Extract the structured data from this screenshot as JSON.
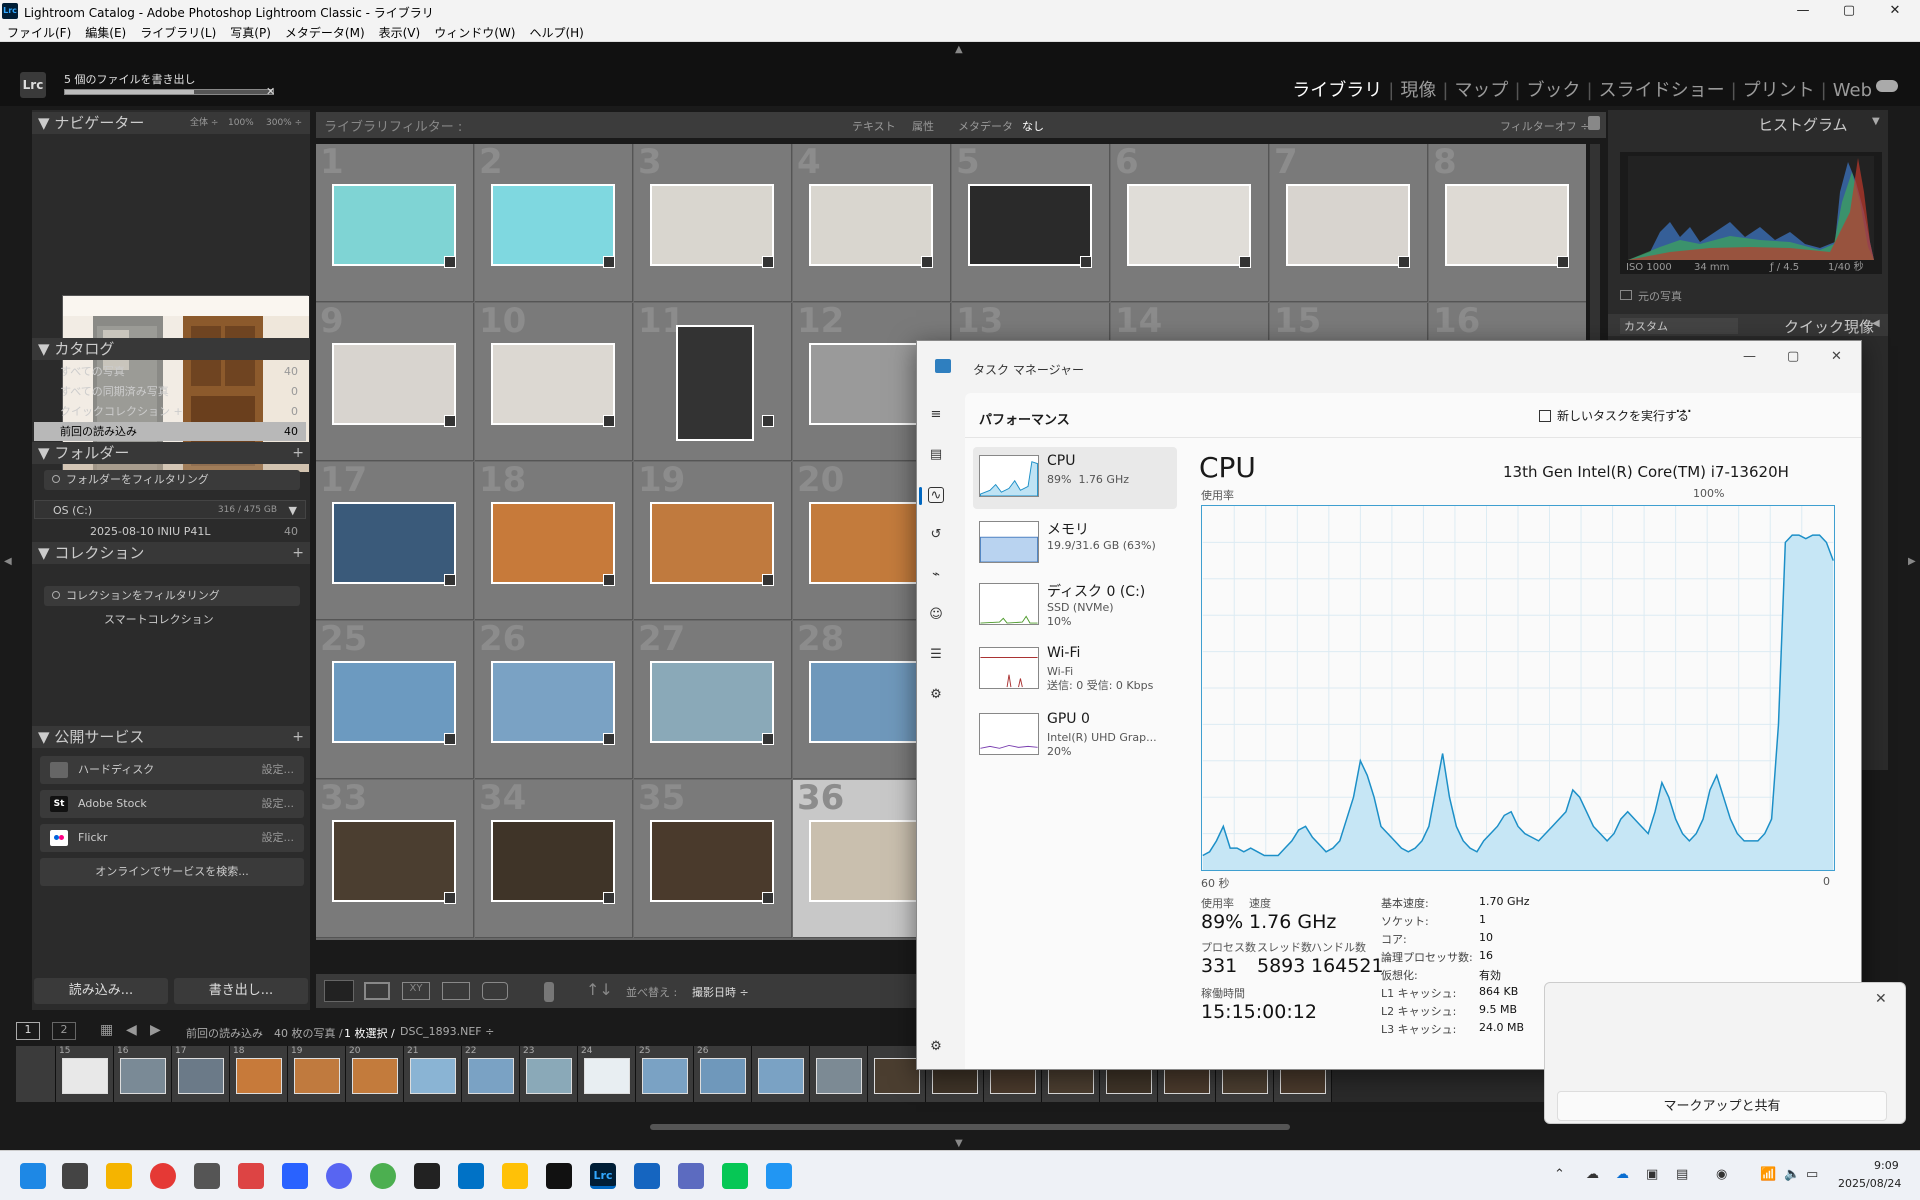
{
  "window": {
    "title": "Lightroom Catalog - Adobe Photoshop Lightroom Classic - ライブラリ",
    "lrc_badge": "Lrc",
    "minimize": "—",
    "maximize": "▢",
    "close": "✕"
  },
  "menu": [
    "ファイル(F)",
    "編集(E)",
    "ライブラリ(L)",
    "写真(P)",
    "メタデータ(M)",
    "表示(V)",
    "ウィンドウ(W)",
    "ヘルプ(H)"
  ],
  "lr": {
    "logo": "Lrc",
    "progress": {
      "label": "5 個のファイルを書き出し",
      "fraction": 0.62,
      "close": "✕"
    },
    "modules": [
      "ライブラリ",
      "現像",
      "マップ",
      "ブック",
      "スライドショー",
      "プリント",
      "Web"
    ],
    "active_module": "ライブラリ",
    "navigator": {
      "title": "ナビゲーター",
      "options": [
        "全体 ÷",
        "100%",
        "300% ÷"
      ]
    },
    "catalog": {
      "title": "カタログ",
      "items": [
        {
          "label": "すべての写真",
          "count": "40"
        },
        {
          "label": "すべての同期済み写真",
          "count": "0"
        },
        {
          "label": "クイックコレクション +",
          "count": "0"
        },
        {
          "label": "前回の読み込み",
          "count": "40"
        }
      ]
    },
    "folders": {
      "title": "フォルダー",
      "filter": "フォルダーをフィルタリング",
      "volume": "OS (C:)",
      "volume_size": "316 / 475 GB",
      "folder": "2025-08-10 INIU P41L",
      "folder_count": "40"
    },
    "collections": {
      "title": "コレクション",
      "filter": "コレクションをフィルタリング",
      "smart": "スマートコレクション"
    },
    "publish": {
      "title": "公開サービス",
      "services": [
        {
          "label": "ハードディスク",
          "setting": "設定..."
        },
        {
          "label": "Adobe Stock",
          "setting": "設定...",
          "icon": "St"
        },
        {
          "label": "Flickr",
          "setting": "設定..."
        }
      ],
      "find": "オンラインでサービスを検索..."
    },
    "buttons": {
      "import": "読み込み...",
      "export": "書き出し..."
    },
    "filter_bar": {
      "title": "ライブラリフィルター :",
      "options": [
        "テキスト",
        "属性",
        "メタデータ",
        "なし"
      ],
      "selected": "なし",
      "preset": "フィルターオフ ÷"
    },
    "grid_numbers": [
      "1",
      "2",
      "3",
      "4",
      "5",
      "6",
      "7",
      "8",
      "9",
      "10",
      "11",
      "12",
      "13",
      "14",
      "15",
      "16",
      "17",
      "18",
      "19",
      "20",
      "",
      "",
      "",
      "",
      "25",
      "26",
      "27",
      "28",
      "",
      "",
      "",
      "",
      "33",
      "34",
      "35",
      "36"
    ],
    "toolbar": {
      "sort_label": "並べ替え :",
      "sort_value": "撮影日時 ÷"
    },
    "filmbar": {
      "screen1": "1",
      "screen2": "2",
      "source": "前回の読み込み",
      "count": "40 枚の写真 /",
      "selected": "1 枚選択 /",
      "file": "DSC_1893.NEF ÷"
    },
    "film_numbers": [
      "15",
      "16",
      "17",
      "18",
      "19",
      "20",
      "21",
      "22",
      "23",
      "24",
      "25",
      "26"
    ],
    "histogram": {
      "title": "ヒストグラム",
      "iso": "ISO 1000",
      "focal": "34 mm",
      "aperture": "ƒ / 4.5",
      "shutter": "1/40 秒",
      "original": "元の写真"
    },
    "quick_develop": {
      "title": "クイック現像",
      "preset": "カスタム"
    }
  },
  "taskmgr": {
    "title": "タスク マネージャー",
    "header": "パフォーマンス",
    "new_task": "新しいタスクを実行する",
    "more": "···",
    "items": [
      {
        "name": "CPU",
        "sub": "89%  1.76 GHz"
      },
      {
        "name": "メモリ",
        "sub": "19.9/31.6 GB (63%)"
      },
      {
        "name": "ディスク 0 (C:)",
        "sub": "SSD (NVMe)\n10%"
      },
      {
        "name": "Wi-Fi",
        "sub": "Wi-Fi\n送信: 0 受信: 0 Kbps"
      },
      {
        "name": "GPU 0",
        "sub": "Intel(R) UHD Grap...\n20%"
      }
    ],
    "cpu_title": "CPU",
    "cpu_model": "13th Gen Intel(R) Core(TM) i7-13620H",
    "graph_label": "使用率",
    "graph_max": "100%",
    "graph_left": "60 秒",
    "graph_right": "0",
    "cpu_history": [
      4,
      5,
      8,
      12,
      6,
      6,
      5,
      6,
      5,
      4,
      4,
      4,
      6,
      8,
      11,
      12,
      9,
      7,
      5,
      6,
      8,
      14,
      20,
      30,
      26,
      20,
      12,
      10,
      8,
      6,
      5,
      6,
      8,
      12,
      22,
      32,
      20,
      12,
      8,
      6,
      5,
      8,
      10,
      12,
      15,
      16,
      12,
      10,
      9,
      8,
      10,
      12,
      14,
      16,
      22,
      20,
      16,
      12,
      10,
      8,
      10,
      14,
      16,
      14,
      12,
      10,
      16,
      24,
      20,
      14,
      10,
      8,
      10,
      14,
      22,
      26,
      20,
      14,
      10,
      8,
      8,
      8,
      10,
      14,
      40,
      90,
      92,
      92,
      91,
      92,
      92,
      90,
      85
    ],
    "stats": [
      {
        "label": "使用率",
        "value": "89%"
      },
      {
        "label": "速度",
        "value": "1.76 GHz"
      },
      {
        "label": "プロセス数",
        "value": "331"
      },
      {
        "label": "スレッド数",
        "value": "5893"
      },
      {
        "label": "ハンドル数",
        "value": "164521"
      },
      {
        "label": "稼働時間",
        "value": "15:15:00:12"
      }
    ],
    "specs": [
      {
        "label": "基本速度:",
        "value": "1.70 GHz"
      },
      {
        "label": "ソケット:",
        "value": "1"
      },
      {
        "label": "コア:",
        "value": "10"
      },
      {
        "label": "論理プロセッサ数:",
        "value": "16"
      },
      {
        "label": "仮想化:",
        "value": "有効"
      },
      {
        "label": "L1 キャッシュ:",
        "value": "864 KB"
      },
      {
        "label": "L2 キャッシュ:",
        "value": "9.5 MB"
      },
      {
        "label": "L3 キャッシュ:",
        "value": "24.0 MB"
      }
    ]
  },
  "markup": {
    "button": "マークアップと共有",
    "close": "✕"
  },
  "taskbar": {
    "time": "9:09",
    "date": "2025/08/24"
  }
}
